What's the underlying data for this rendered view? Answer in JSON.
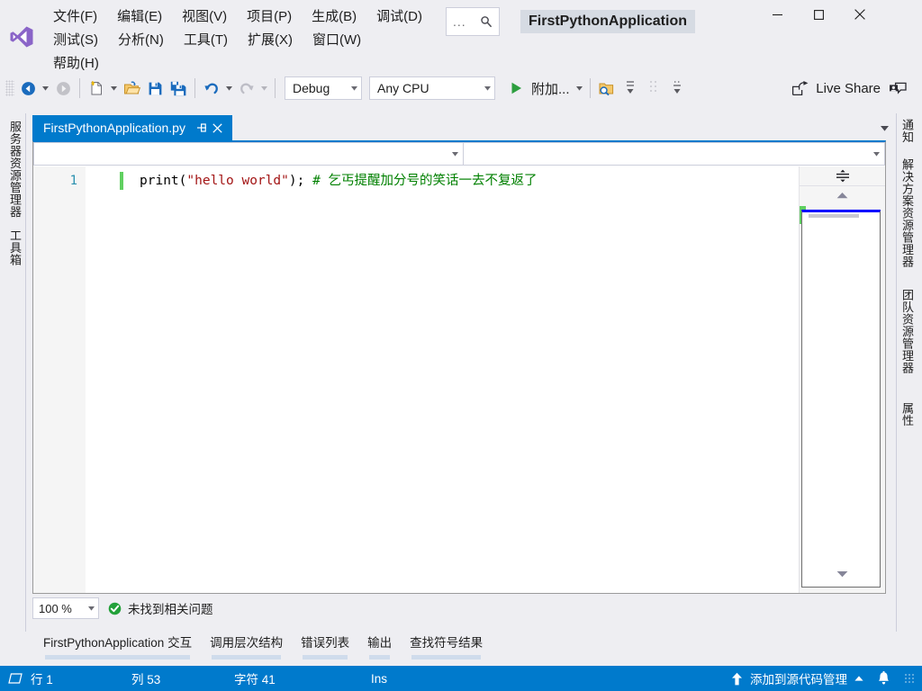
{
  "window": {
    "title": "FirstPythonApplication",
    "minimize_label": "最小化",
    "maximize_label": "最大化",
    "close_label": "关闭"
  },
  "search": {
    "dots": "...",
    "icon": "search-icon"
  },
  "menu": {
    "row1": [
      "文件(F)",
      "编辑(E)",
      "视图(V)",
      "项目(P)",
      "生成(B)",
      "调试(D)"
    ],
    "row2": [
      "测试(S)",
      "分析(N)",
      "工具(T)",
      "扩展(X)",
      "窗口(W)"
    ],
    "row3": [
      "帮助(H)"
    ]
  },
  "toolbar": {
    "back_icon": "navigate-backward-icon",
    "forward_icon": "navigate-forward-icon",
    "new_item_icon": "new-item-icon",
    "open_icon": "open-file-icon",
    "save_icon": "save-icon",
    "save_all_icon": "save-all-icon",
    "undo_icon": "undo-icon",
    "redo_icon": "redo-icon",
    "configuration": "Debug",
    "platform": "Any CPU",
    "startup_project": "",
    "run_label": "附加...",
    "run_icon": "play-icon",
    "find_icon": "find-in-files-icon",
    "live_share_label": "Live Share",
    "live_share_icon": "share-icon",
    "feedback_icon": "feedback-icon"
  },
  "left_rail": {
    "items": [
      "服务器资源管理器",
      "工具箱"
    ]
  },
  "right_rail": {
    "items": [
      "通知",
      "解决方案资源管理器",
      "团队资源管理器",
      "属性"
    ]
  },
  "editor": {
    "tab_title": "FirstPythonApplication.py",
    "pin_icon": "pin-icon",
    "close_icon": "close-icon",
    "overflow_icon": "chevron-down-icon",
    "nav_type": "",
    "nav_member": "",
    "line_number": "1",
    "code": {
      "prefix": "print(",
      "string": "\"hello world\"",
      "suffix": "); ",
      "comment": "# 乞丐提醒加分号的笑话一去不复返了"
    },
    "zoom_level": "100 %",
    "issue_status": "未找到相关问题",
    "issue_icon": "check-circle-icon",
    "split_icon": "split-handle-icon",
    "scroll_up_icon": "scroll-up-icon",
    "scroll_down_icon": "scroll-down-icon"
  },
  "bottom_tabs": [
    "FirstPythonApplication 交互",
    "调用层次结构",
    "错误列表",
    "输出",
    "查找符号结果"
  ],
  "status": {
    "ready_icon": "ready-icon",
    "line": "行 1",
    "column": "列 53",
    "chars": "字符 41",
    "insert_mode": "Ins",
    "source_control": "添加到源代码管理",
    "source_control_icon": "upload-arrow-icon",
    "source_control_caret": "caret-up-icon",
    "notification_icon": "bell-icon"
  },
  "colors": {
    "accent": "#007acc",
    "chrome": "#eeeef2",
    "string": "#a31515",
    "comment": "#008000",
    "line_number": "#2b91af",
    "change_marker": "#60d060",
    "logo_purple": "#8a64c8"
  }
}
